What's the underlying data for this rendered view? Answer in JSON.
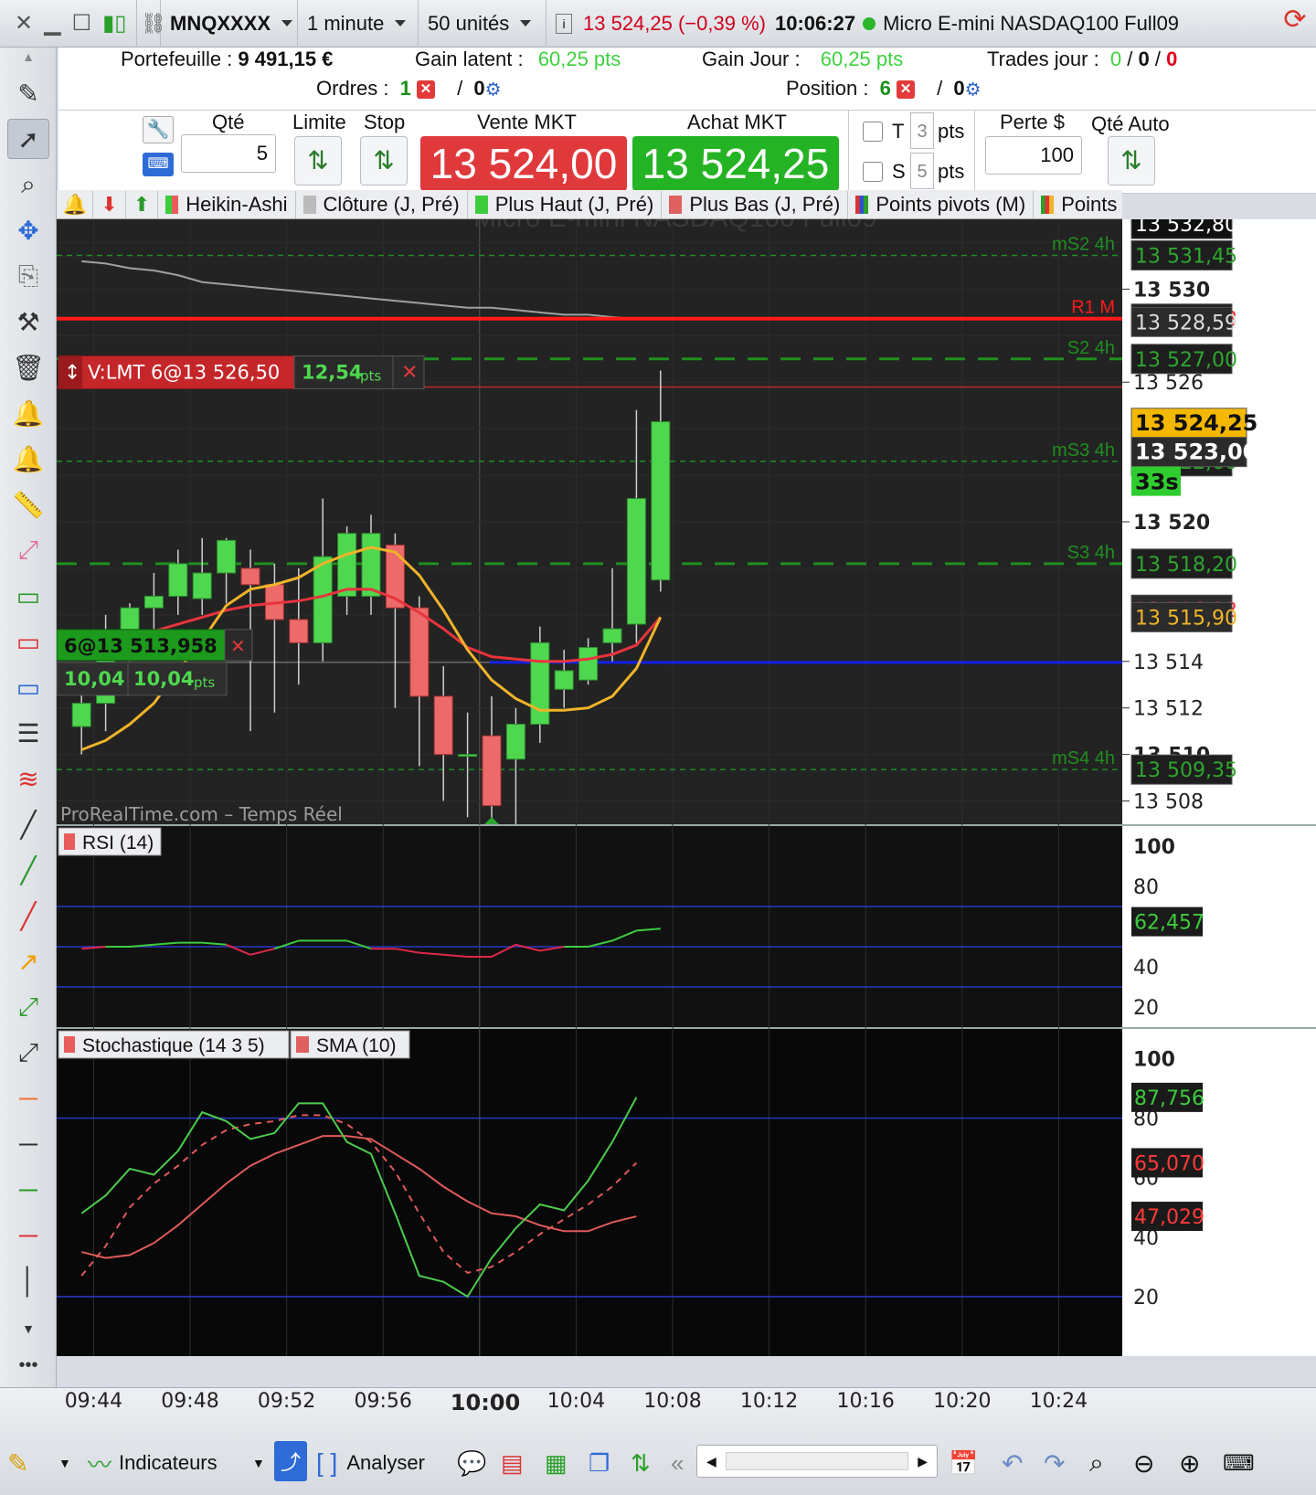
{
  "topbar": {
    "symbol": "MNQXXXX",
    "timeframe": "1 minute",
    "units": "50 unités",
    "price_change": "13 524,25 (−0,39 %)",
    "time": "10:06:27",
    "instrument": "Micro E-mini NASDAQ100 Full09"
  },
  "account": {
    "portfolio_label": "Portefeuille :",
    "portfolio_value": "9 491,15 €",
    "latent_label": "Gain latent :",
    "latent_value": "60,25 pts",
    "day_label": "Gain Jour :",
    "day_value": "60,25 pts",
    "trades_label": "Trades jour :",
    "trades_a": "0",
    "trades_b": "0",
    "trades_c": "0",
    "slash": "/",
    "orders_label": "Ordres :",
    "orders_count": "1",
    "orders_auto": "0",
    "position_label": "Position :",
    "position_count": "6",
    "position_auto": "0"
  },
  "orderbar": {
    "qty_label": "Qté",
    "qty_value": "5",
    "limit_label": "Limite",
    "stop_label": "Stop",
    "sell_label": "Vente MKT",
    "sell_price": "13 524,00",
    "buy_label": "Achat MKT",
    "buy_price": "13 524,25",
    "t_label": "T",
    "t_value": "3",
    "s_label": "S",
    "s_value": "5",
    "pts": "pts",
    "loss_label": "Perte $",
    "loss_value": "100",
    "auto_qty_label": "Qté Auto"
  },
  "chart_header": {
    "items": [
      "Heikin-Ashi",
      "Clôture (J, Pré)",
      "Plus Haut (J, Pré)",
      "Plus Bas (J, Pré)",
      "Points pivots (M)",
      "Points"
    ],
    "colors": [
      "#e85c5c",
      "#bbbbbb",
      "#3ccc3c",
      "#e06060",
      "#3050d0",
      "#2aa02a"
    ]
  },
  "chart_data": [
    {
      "type": "candlestick",
      "title": "Micro E-mini NASDAQ100 Full09",
      "watermark": "ProRealTime.com – Temps Réel",
      "ylim": [
        13507,
        13533
      ],
      "x_ticks": [
        "09:44",
        "09:48",
        "09:52",
        "09:56",
        "10:00",
        "10:04",
        "10:08",
        "10:12",
        "10:16",
        "10:20",
        "10:24"
      ],
      "x_start": "09:43",
      "y_ticks": [
        "13 530",
        "13 526",
        "13 520",
        "13 514",
        "13 512",
        "13 510",
        "13 508"
      ],
      "candles": [
        {
          "t": "09:43",
          "o": 13511.2,
          "h": 13513.5,
          "l": 13510.0,
          "c": 13512.2
        },
        {
          "t": "09:44",
          "o": 13512.2,
          "h": 13516.0,
          "l": 13511.0,
          "c": 13515.2
        },
        {
          "t": "09:45",
          "o": 13515.2,
          "h": 13516.5,
          "l": 13514.0,
          "c": 13516.3
        },
        {
          "t": "09:46",
          "o": 13516.3,
          "h": 13517.8,
          "l": 13515.0,
          "c": 13516.8
        },
        {
          "t": "09:47",
          "o": 13516.8,
          "h": 13518.8,
          "l": 13516.0,
          "c": 13518.2
        },
        {
          "t": "09:48",
          "o": 13516.7,
          "h": 13519.3,
          "l": 13516.0,
          "c": 13517.8
        },
        {
          "t": "09:49",
          "o": 13517.8,
          "h": 13519.3,
          "l": 13516.5,
          "c": 13519.2
        },
        {
          "t": "09:50",
          "o": 13518.0,
          "h": 13518.8,
          "l": 13511.0,
          "c": 13517.3
        },
        {
          "t": "09:51",
          "o": 13517.3,
          "h": 13518.2,
          "l": 13511.8,
          "c": 13515.8
        },
        {
          "t": "09:52",
          "o": 13515.8,
          "h": 13518.0,
          "l": 13513.0,
          "c": 13514.8
        },
        {
          "t": "09:53",
          "o": 13514.8,
          "h": 13521.0,
          "l": 13514.0,
          "c": 13518.5
        },
        {
          "t": "09:54",
          "o": 13516.8,
          "h": 13519.8,
          "l": 13516.0,
          "c": 13519.5
        },
        {
          "t": "09:55",
          "o": 13516.8,
          "h": 13520.3,
          "l": 13516.0,
          "c": 13519.5
        },
        {
          "t": "09:56",
          "o": 13519.0,
          "h": 13519.5,
          "l": 13512.0,
          "c": 13516.3
        },
        {
          "t": "09:57",
          "o": 13516.3,
          "h": 13516.8,
          "l": 13509.5,
          "c": 13512.5
        },
        {
          "t": "09:58",
          "o": 13512.5,
          "h": 13513.8,
          "l": 13508.0,
          "c": 13510.0
        },
        {
          "t": "09:59",
          "o": 13510.0,
          "h": 13511.8,
          "l": 13507.3,
          "c": 13510.0
        },
        {
          "t": "10:00",
          "o": 13510.8,
          "h": 13512.5,
          "l": 13507.0,
          "c": 13507.8
        },
        {
          "t": "10:01",
          "o": 13509.8,
          "h": 13512.0,
          "l": 13507.0,
          "c": 13511.3
        },
        {
          "t": "10:02",
          "o": 13511.3,
          "h": 13515.5,
          "l": 13510.5,
          "c": 13514.8
        },
        {
          "t": "10:03",
          "o": 13512.8,
          "h": 13514.5,
          "l": 13512.0,
          "c": 13513.6
        },
        {
          "t": "10:04",
          "o": 13513.2,
          "h": 13515.0,
          "l": 13513.0,
          "c": 13514.6
        },
        {
          "t": "10:05",
          "o": 13514.8,
          "h": 13518.0,
          "l": 13514.0,
          "c": 13515.4
        },
        {
          "t": "10:06",
          "o": 13515.6,
          "h": 13524.8,
          "l": 13514.8,
          "c": 13521.0
        },
        {
          "t": "10:07",
          "o": 13517.5,
          "h": 13526.5,
          "l": 13517.0,
          "c": 13524.3
        }
      ],
      "series": [
        {
          "name": "Clôture (J, Pré)",
          "color": "#bbbbbb",
          "values": [
            13531.2,
            13531.1,
            13530.9,
            13530.8,
            13530.6,
            13530.3,
            13530.2,
            13530.1,
            13530.0,
            13529.9,
            13529.8,
            13529.7,
            13529.6,
            13529.5,
            13529.4,
            13529.3,
            13529.2,
            13529.2,
            13529.1,
            13529.0,
            13528.9,
            13528.9,
            13528.8,
            13528.7,
            13528.7
          ]
        },
        {
          "name": "SMA",
          "color": "#e8343c",
          "values": [
            13514.5,
            13514.6,
            13514.9,
            13515.3,
            13515.6,
            13515.9,
            13516.2,
            13516.4,
            13516.5,
            13516.6,
            13516.8,
            13517.1,
            13517.1,
            13516.7,
            13516.1,
            13515.4,
            13514.6,
            13514.2,
            13514.1,
            13514.0,
            13514.0,
            13514.1,
            13514.3,
            13514.7,
            13515.9
          ]
        },
        {
          "name": "EMA",
          "color": "#f0b429",
          "values": [
            13510.2,
            13510.6,
            13511.3,
            13512.2,
            13513.6,
            13514.9,
            13516.4,
            13517.1,
            13517.3,
            13517.6,
            13518.2,
            13518.6,
            13518.9,
            13518.7,
            13517.7,
            13516.2,
            13514.5,
            13513.2,
            13512.4,
            13511.9,
            13511.9,
            13512.0,
            13512.5,
            13513.7,
            13515.9
          ]
        }
      ],
      "levels": [
        {
          "label": "mS2 4h",
          "value": "13 531,45",
          "color": "#1f8f1f",
          "style": "dash"
        },
        {
          "label": "R1 M",
          "value": "13 528,73",
          "color": "#ff1a1a",
          "style": "solid"
        },
        {
          "label": "S2 4h",
          "value": "13 527,00",
          "color": "#1f8f1f",
          "style": "dash"
        },
        {
          "label": "mS3 4h",
          "value": "13 522,60",
          "color": "#1f8f1f",
          "style": "dash"
        },
        {
          "label": "S3 4h",
          "value": "13 518,20",
          "color": "#1f8f1f",
          "style": "dash"
        },
        {
          "label": "mS4 4h",
          "value": "13 509,35",
          "color": "#1f8f1f",
          "style": "dash"
        }
      ],
      "price_tags": [
        {
          "value": "13 532,80",
          "bg": "#111",
          "fg": "#fff"
        },
        {
          "value": "13 528,59",
          "bg": "#2b2b2b",
          "fg": "#ddd"
        },
        {
          "value": "13 524,25",
          "bg": "#f5b800",
          "fg": "#111"
        },
        {
          "value": "13 523,00",
          "bg": "#2b2b2b",
          "fg": "#fff"
        },
        {
          "value": "13 516,22",
          "bg": "#2b2b2b",
          "fg": "#e8343c"
        },
        {
          "value": "13 515,90",
          "bg": "#2b2b2b",
          "fg": "#f0b429"
        }
      ],
      "timer": "33s",
      "position_line": {
        "price": 13513.958,
        "qty_label": "6@13 513,958",
        "gain1": "10,04",
        "gain2": "10,04",
        "unit": "pts"
      },
      "limit_order": {
        "price": 13526.5,
        "label": "V:LMT  6@13 526,50",
        "dist": "12,54",
        "unit": "pts"
      }
    },
    {
      "type": "line",
      "title": "RSI (14)",
      "ylim": [
        10,
        110
      ],
      "y_ticks": [
        "100",
        "80",
        "40",
        "20"
      ],
      "levels": [
        70,
        50,
        30
      ],
      "current": "62,457",
      "series": [
        {
          "name": "RSI (14)",
          "values": [
            49,
            50,
            50,
            51,
            52,
            52,
            51,
            46,
            49,
            53,
            53,
            53,
            49,
            49,
            47,
            46,
            45,
            45,
            51,
            48,
            50,
            50,
            53,
            58,
            59
          ]
        }
      ]
    },
    {
      "type": "line",
      "title": "Stochastique (14 3 5)",
      "ylim": [
        0,
        110
      ],
      "y_ticks": [
        "100",
        "80",
        "60",
        "40",
        "20"
      ],
      "levels": [
        80,
        20
      ],
      "sma_label": "SMA (10)",
      "current": [
        "87,756",
        "65,070",
        "47,029"
      ],
      "series": [
        {
          "name": "Stochastique (14 3 5)",
          "color": "#4ccc4c",
          "values": [
            48,
            54,
            63,
            61,
            69,
            82,
            79,
            73,
            75,
            85,
            85,
            72,
            68,
            48,
            27,
            25,
            20,
            33,
            43,
            51,
            49,
            59,
            72,
            87
          ]
        },
        {
          "name": "Stochastique (14 3 5) %D",
          "color": "#e05a5a",
          "dash": true,
          "values": [
            27,
            37,
            50,
            58,
            64,
            71,
            76,
            78,
            79,
            81,
            81,
            78,
            72,
            62,
            48,
            35,
            28,
            30,
            35,
            41,
            46,
            51,
            57,
            65
          ]
        },
        {
          "name": "SMA (10)",
          "color": "#e05a5a",
          "values": [
            35,
            33,
            34,
            38,
            44,
            51,
            58,
            64,
            68,
            71,
            74,
            74,
            73,
            68,
            63,
            57,
            52,
            48,
            47,
            44,
            42,
            42,
            45,
            47
          ]
        }
      ]
    }
  ],
  "bottombar": {
    "indicators": "Indicateurs",
    "analyse": "Analyser"
  }
}
